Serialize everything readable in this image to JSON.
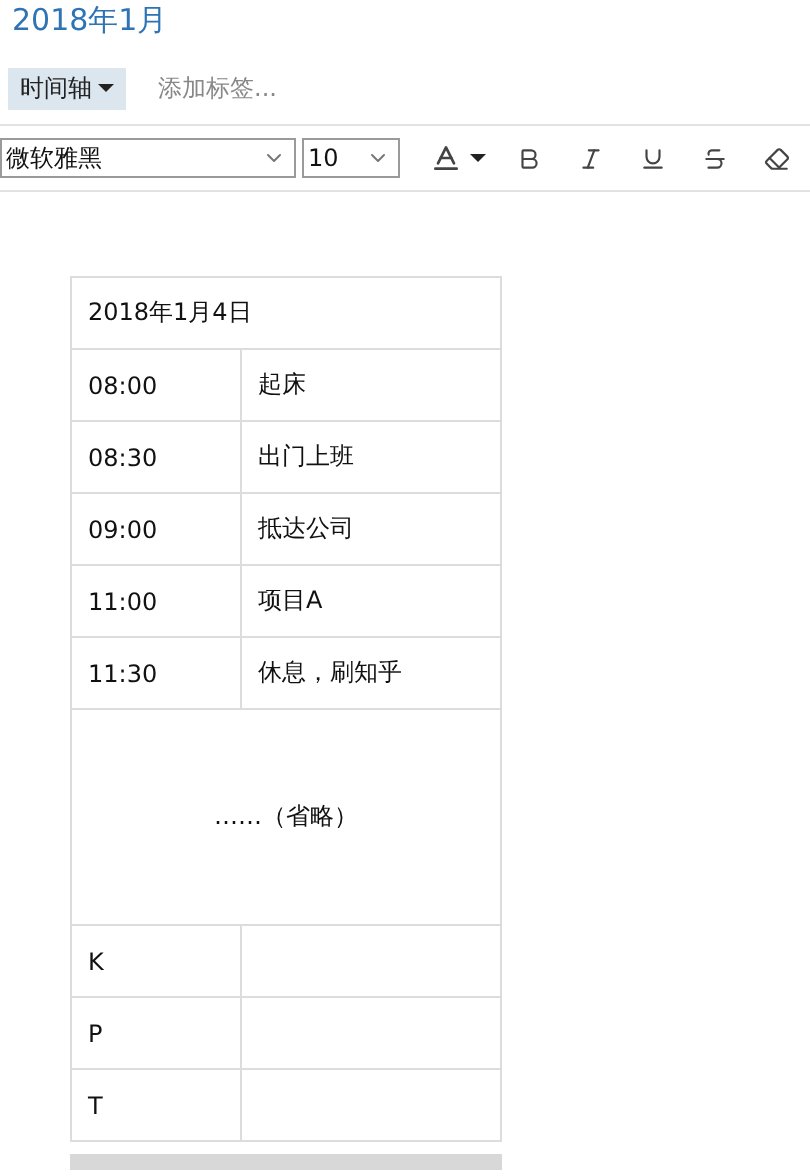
{
  "title": "2018年1月",
  "tags": {
    "dropdown": "时间轴",
    "placeholder": "添加标签..."
  },
  "toolbar": {
    "font": "微软雅黑",
    "size": "10"
  },
  "table": {
    "heading": "2018年1月4日",
    "rows": [
      {
        "time": "08:00",
        "event": "起床"
      },
      {
        "time": "08:30",
        "event": "出门上班"
      },
      {
        "time": "09:00",
        "event": "抵达公司"
      },
      {
        "time": "11:00",
        "event": "项目A"
      },
      {
        "time": "11:30",
        "event": "休息，刷知乎"
      }
    ],
    "note": "……（省略）",
    "tail_rows": [
      {
        "label": "K"
      },
      {
        "label": "P"
      },
      {
        "label": "T"
      }
    ]
  }
}
